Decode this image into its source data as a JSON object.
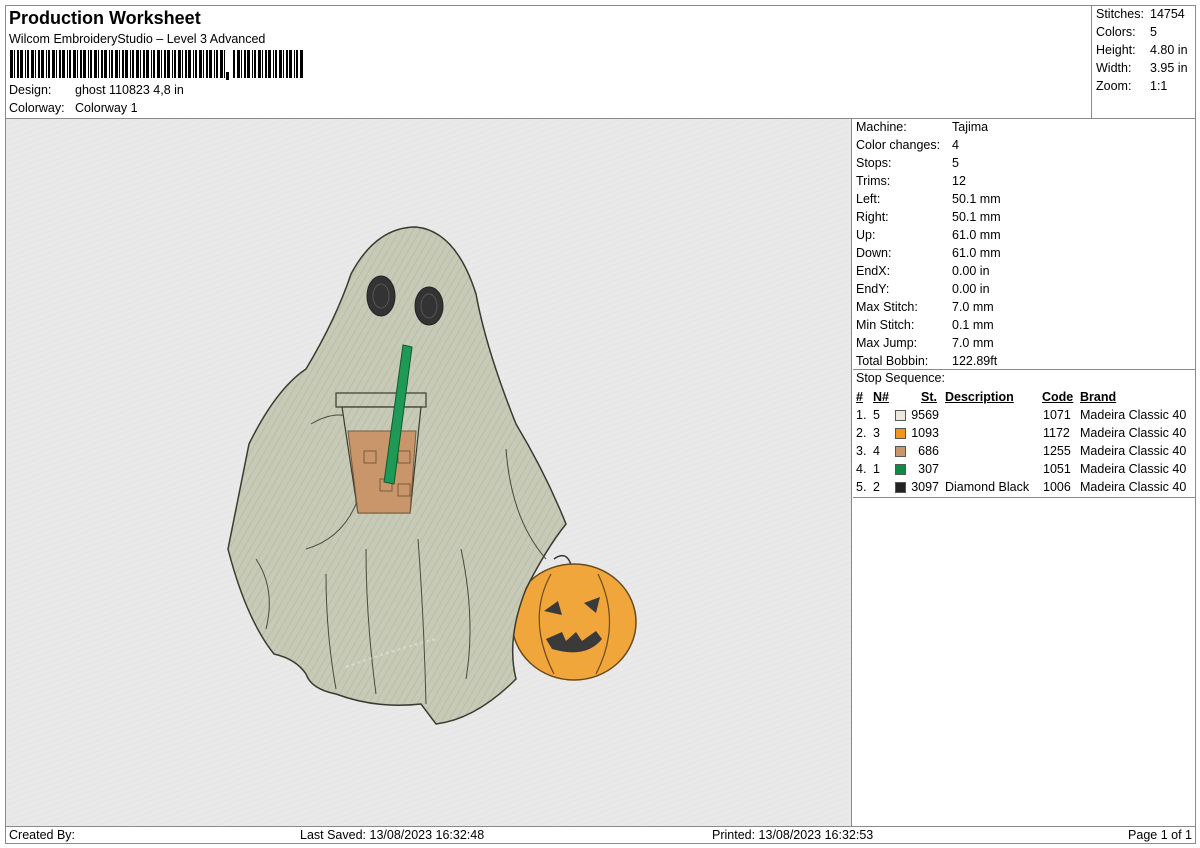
{
  "header": {
    "title": "Production Worksheet",
    "subtitle": "Wilcom EmbroideryStudio – Level 3 Advanced",
    "design_label": "Design:",
    "design_value": "ghost 110823 4,8 in",
    "colorway_label": "Colorway:",
    "colorway_value": "Colorway 1"
  },
  "summary": [
    {
      "label": "Stitches:",
      "value": "14754"
    },
    {
      "label": "Colors:",
      "value": "5"
    },
    {
      "label": "Height:",
      "value": "4.80 in"
    },
    {
      "label": "Width:",
      "value": "3.95 in"
    },
    {
      "label": "Zoom:",
      "value": "1:1"
    }
  ],
  "machine_info": [
    {
      "label": "Machine:",
      "value": "Tajima"
    },
    {
      "label": "Color changes:",
      "value": "4"
    },
    {
      "label": "Stops:",
      "value": "5"
    },
    {
      "label": "Trims:",
      "value": "12"
    },
    {
      "label": "Left:",
      "value": "50.1 mm"
    },
    {
      "label": "Right:",
      "value": "50.1 mm"
    },
    {
      "label": "Up:",
      "value": "61.0 mm"
    },
    {
      "label": "Down:",
      "value": "61.0 mm"
    },
    {
      "label": "EndX:",
      "value": "0.00 in"
    },
    {
      "label": "EndY:",
      "value": "0.00 in"
    },
    {
      "label": "Max Stitch:",
      "value": "7.0 mm"
    },
    {
      "label": "Min Stitch:",
      "value": "0.1 mm"
    },
    {
      "label": "Max Jump:",
      "value": "7.0 mm"
    },
    {
      "label": "Total Bobbin:",
      "value": "122.89ft"
    }
  ],
  "stop_sequence": {
    "title": "Stop Sequence:",
    "headers": {
      "num": "#",
      "needle": "N#",
      "stitch": "St.",
      "description": "Description",
      "code": "Code",
      "brand": "Brand"
    },
    "rows": [
      {
        "num": "1.",
        "needle": "5",
        "stitch": "9569",
        "description": "",
        "code": "1071",
        "brand": "Madeira Classic 40",
        "color": "#ece8e0"
      },
      {
        "num": "2.",
        "needle": "3",
        "stitch": "1093",
        "description": "",
        "code": "1172",
        "brand": "Madeira Classic 40",
        "color": "#f0961e"
      },
      {
        "num": "3.",
        "needle": "4",
        "stitch": "686",
        "description": "",
        "code": "1255",
        "brand": "Madeira Classic 40",
        "color": "#c8966a"
      },
      {
        "num": "4.",
        "needle": "1",
        "stitch": "307",
        "description": "",
        "code": "1051",
        "brand": "Madeira Classic 40",
        "color": "#0f8a46"
      },
      {
        "num": "5.",
        "needle": "2",
        "stitch": "3097",
        "description": "Diamond Black",
        "code": "1006",
        "brand": "Madeira Classic 40",
        "color": "#222222"
      }
    ]
  },
  "footer": {
    "created_by": "Created By:",
    "last_saved": "Last Saved: 13/08/2023 16:32:48",
    "printed": "Printed: 13/08/2023 16:32:53",
    "page": "Page 1 of 1"
  },
  "icons": [
    "barcode-icon",
    "ghost-embroidery-preview"
  ]
}
